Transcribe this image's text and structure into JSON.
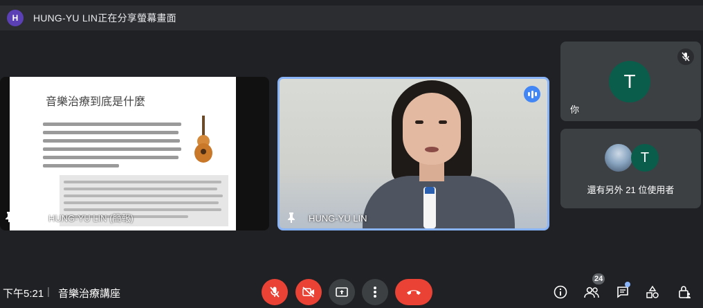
{
  "banner": {
    "avatar_letter": "H",
    "text": "HUNG-YU LIN正在分享螢幕畫面"
  },
  "presentation": {
    "slide_title": "音樂治療到底是什麼",
    "presenter_label": "HUNG-YU LIN (簡報)"
  },
  "speaker": {
    "name": "HUNG-YU LIN"
  },
  "self_tile": {
    "avatar_letter": "T",
    "label": "你"
  },
  "others_tile": {
    "avatar_letter": "T",
    "label": "還有另外 21 位使用者"
  },
  "bottom_bar": {
    "time": "下午5:21",
    "separator": "|",
    "meeting_title": "音樂治療講座",
    "participants_count": "24"
  },
  "colors": {
    "background": "#202124",
    "tile": "#3c4043",
    "danger": "#ea4335",
    "active_border": "#8ab4f8",
    "avatar_green": "#0b5d4b"
  }
}
